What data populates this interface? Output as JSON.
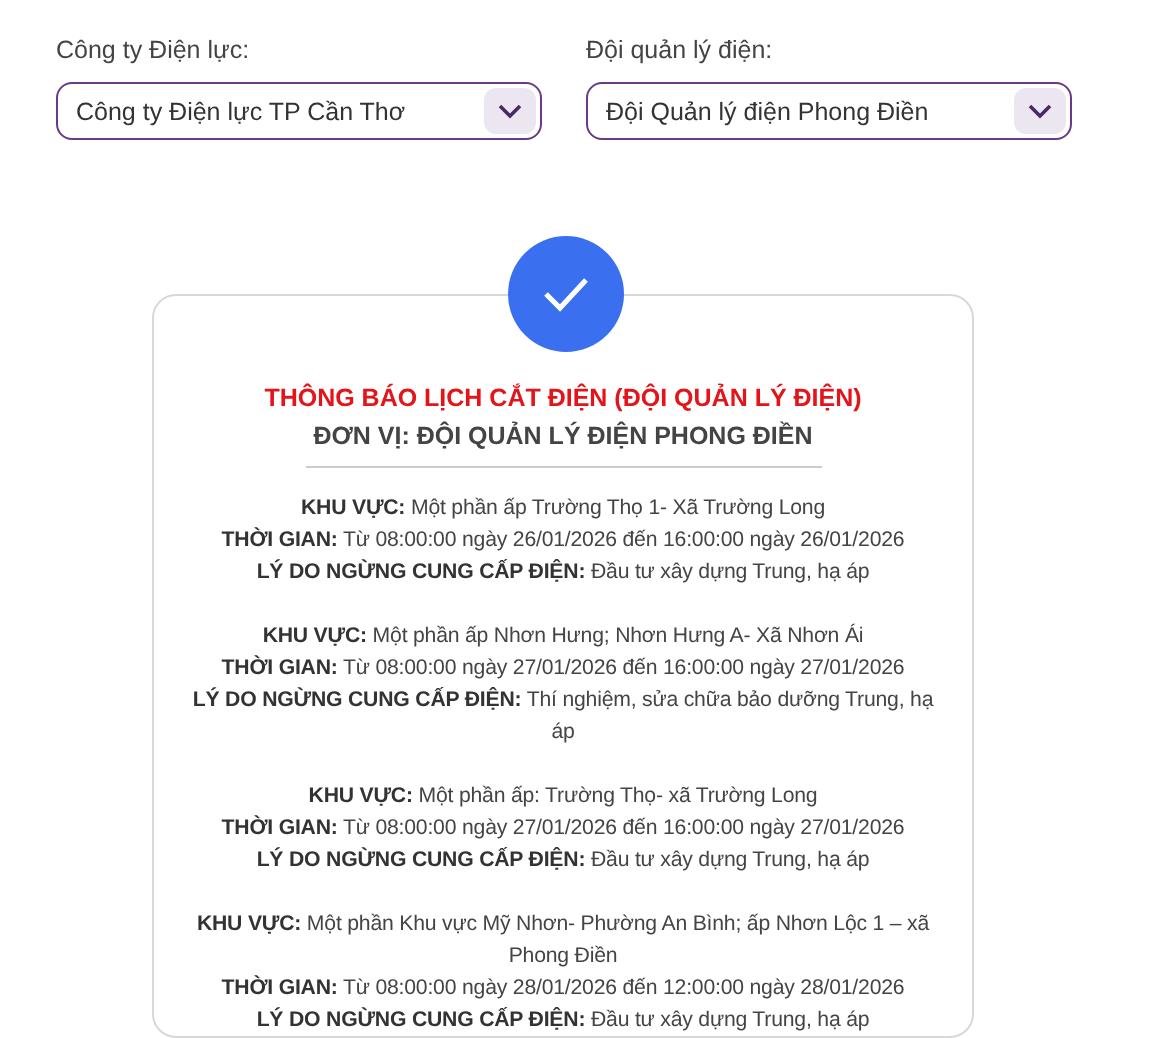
{
  "filters": [
    {
      "label": "Công ty Điện lực:",
      "value": "Công ty Điện lực TP Cần Thơ"
    },
    {
      "label": "Đội quản lý điện:",
      "value": "Đội Quản lý điện Phong Điền"
    }
  ],
  "notice": {
    "title": "THÔNG BÁO LỊCH CẮT ĐIỆN (ĐỘI QUẢN LÝ ĐIỆN)",
    "unit": "ĐƠN VỊ: ĐỘI QUẢN LÝ ĐIỆN PHONG ĐIỀN",
    "entries": [
      {
        "lines": [
          "**KHU VỰC:** Một phần ấp Trường Thọ 1- Xã Trường Long",
          "**THỜI GIAN:** Từ 08:00:00 ngày 26/01/2026 đến 16:00:00 ngày 26/01/2026",
          "**LÝ DO NGỪNG CUNG CẤP ĐIỆN:** Đầu tư xây dựng Trung, hạ áp"
        ]
      },
      {
        "lines": [
          "**KHU VỰC:** Một phần ấp Nhơn Hưng; Nhơn Hưng A- Xã Nhơn Ái",
          "**THỜI GIAN:** Từ 08:00:00 ngày 27/01/2026 đến 16:00:00 ngày 27/01/2026",
          "**LÝ DO NGỪNG CUNG CẤP ĐIỆN:** Thí nghiệm, sửa chữa bảo dưỡng Trung, hạ áp"
        ]
      },
      {
        "lines": [
          "**KHU VỰC:** Một phần ấp: Trường Thọ- xã Trường Long",
          "**THỜI GIAN:** Từ 08:00:00 ngày 27/01/2026 đến 16:00:00 ngày 27/01/2026",
          "**LÝ DO NGỪNG CUNG CẤP ĐIỆN:** Đầu tư xây dựng Trung, hạ áp"
        ]
      },
      {
        "lines": [
          "**KHU VỰC:** Một phần Khu vực Mỹ Nhơn- Phường An Bình; ấp Nhơn Lộc 1 – xã Phong Điền",
          "**THỜI GIAN:** Từ 08:00:00 ngày 28/01/2026 đến 12:00:00 ngày 28/01/2026",
          "**LÝ DO NGỪNG CUNG CẤP ĐIỆN:** Đầu tư xây dựng Trung, hạ áp"
        ]
      }
    ]
  }
}
